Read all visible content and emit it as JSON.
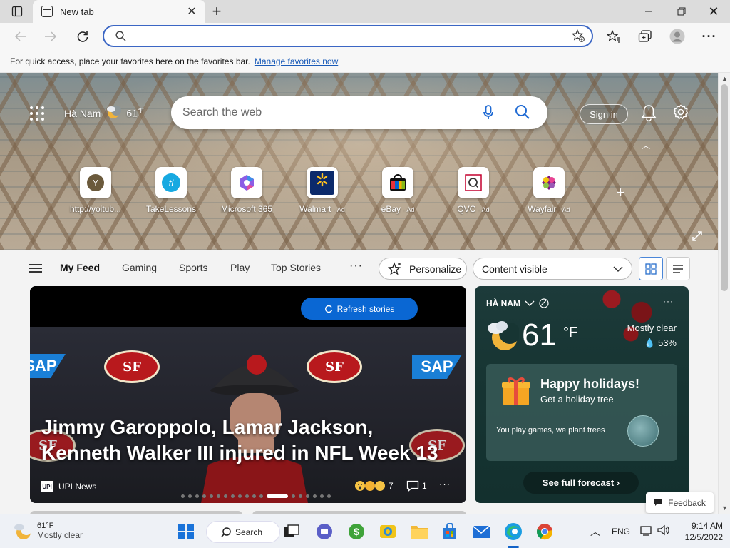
{
  "browser": {
    "tab_title": "New tab",
    "address_value": "",
    "favorites_bar_text": "For quick access, place your favorites here on the favorites bar.",
    "favorites_bar_link": "Manage favorites now"
  },
  "hero": {
    "location": "Hà Nam",
    "temperature": "61",
    "temp_unit": "°F",
    "search_placeholder": "Search the web",
    "sign_in": "Sign in",
    "quick_links": [
      {
        "label": "http://yoitub...",
        "ad": "",
        "icon": "Y"
      },
      {
        "label": "TakeLessons",
        "ad": "",
        "icon": "takelessons"
      },
      {
        "label": "Microsoft 365",
        "ad": "",
        "icon": "m365"
      },
      {
        "label": "Walmart",
        "ad": "· Ad",
        "icon": "walmart"
      },
      {
        "label": "eBay",
        "ad": "· Ad",
        "icon": "ebay"
      },
      {
        "label": "QVC",
        "ad": "· Ad",
        "icon": "qvc"
      },
      {
        "label": "Wayfair",
        "ad": "· Ad",
        "icon": "wayfair"
      }
    ]
  },
  "feed_nav": {
    "tabs": [
      "My Feed",
      "Gaming",
      "Sports",
      "Play",
      "Top Stories"
    ],
    "active_tab": "My Feed",
    "personalize": "Personalize",
    "content_select": "Content visible"
  },
  "story": {
    "refresh_label": "Refresh stories",
    "headline": "Jimmy Garoppolo, Lamar Jackson, Kenneth Walker III injured in NFL Week 13",
    "source": "UPI News",
    "source_logo": "UPI",
    "reactions_count": "7",
    "comments_count": "1",
    "carousel_total": 19,
    "carousel_active": 12,
    "logo_text": "SF",
    "sponsor": "SAP"
  },
  "weather_card": {
    "location": "HÀ NAM",
    "temperature": "61",
    "unit": "°F",
    "condition": "Mostly clear",
    "humidity": "53%",
    "promo_title": "Happy holidays!",
    "promo_subtitle": "Get a holiday tree",
    "promo_note": "You play games, we plant trees",
    "forecast_button": "See full forecast"
  },
  "feedback": "Feedback",
  "taskbar": {
    "weather_temp": "61°F",
    "weather_cond": "Mostly clear",
    "search_label": "Search",
    "language": "ENG",
    "time": "9:14 AM",
    "date": "12/5/2022"
  },
  "colors": {
    "accent_blue": "#0a67d3",
    "address_border": "#3b66c4",
    "weather_card_bg": "#173533"
  }
}
